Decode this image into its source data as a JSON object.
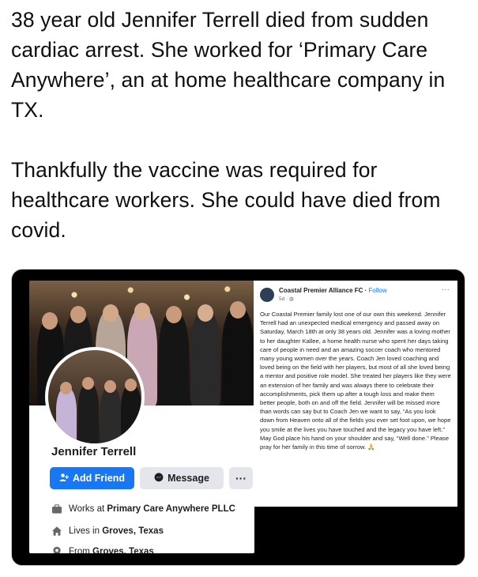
{
  "tweet": {
    "paragraph1": "38 year old Jennifer Terrell died from sudden cardiac arrest. She worked for ‘Primary Care Anywhere’, an at home healthcare company in TX.",
    "paragraph2": "Thankfully the vaccine was required for healthcare workers. She could have died from covid."
  },
  "profile": {
    "name": "Jennifer Terrell",
    "add_friend_label": "Add Friend",
    "message_label": "Message",
    "more_label": "···",
    "works_prefix": "Works at ",
    "works_value": "Primary Care Anywhere PLLC",
    "lives_prefix": "Lives in ",
    "lives_value": "Groves, Texas",
    "from_prefix": "From ",
    "from_value": "Groves, Texas"
  },
  "post": {
    "page_name": "Coastal Premier Alliance FC",
    "separator": " · ",
    "follow_label": "Follow",
    "meta": "5d · ◍",
    "more_label": "···",
    "body": "Our Coastal Premier family lost one of our own this weekend. Jennifer Terrell had an unexpected medical emergency and passed away on Saturday, March 18th at only 38 years old. Jennifer was a loving mother to her daughter Kallee, a home health nurse who spent her days taking care of people in need and an amazing soccer coach who mentored many young women over the years. Coach Jen loved coaching and loved being on the field with her players, but most of all she loved being a mentor and positive role model. She treated her players like they were an extension of her family and was always there to celebrate their accomplishments, pick them up after a tough loss and make them better people, both on and off the field. Jennifer will be missed more than words can say but to Coach Jen we want to say, “As you look down from Heaven onto all of the fields you ever set foot upon, we hope you smile at the lives you have touched and the legacy you have left.” May God place his hand on your shoulder and say, “Well done.” Please pray for her family in this time of sorrow. 🙏"
  },
  "colors": {
    "facebook_blue": "#1877f2",
    "button_gray": "#e4e6eb",
    "card_background": "#000000"
  }
}
